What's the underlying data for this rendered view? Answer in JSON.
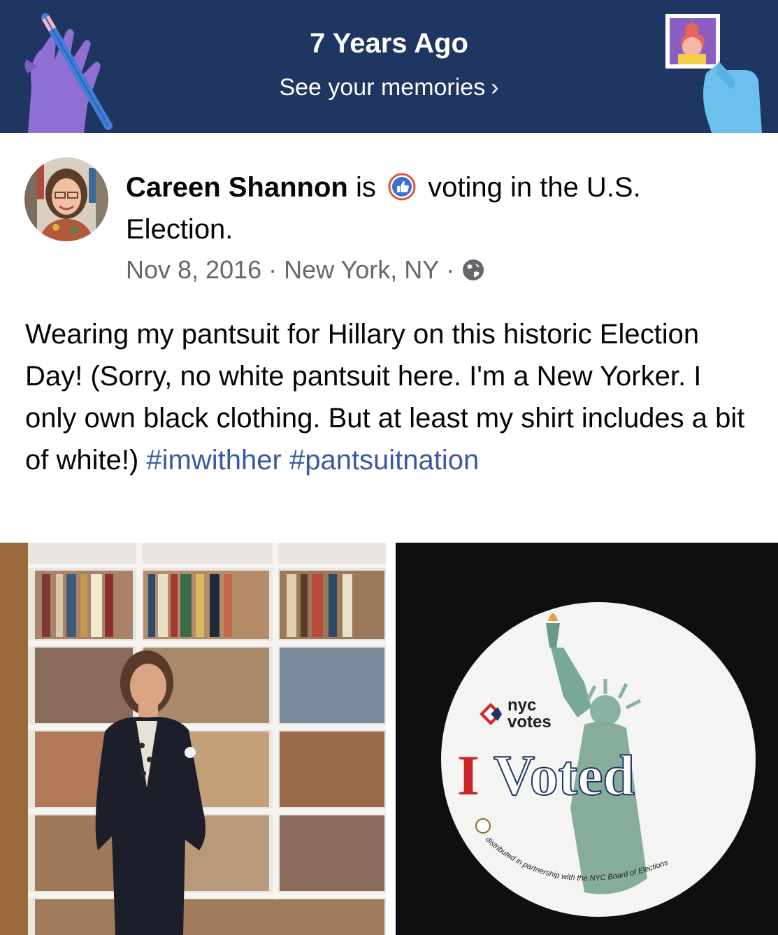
{
  "banner": {
    "title": "7 Years Ago",
    "link": "See your memories",
    "chevron": "›",
    "bg_color": "#1f3562"
  },
  "post": {
    "author": "Careen Shannon",
    "verb": "is",
    "activity_icon": "thumbs-up-icon",
    "activity": "voting in the U.S. Election.",
    "date": "Nov 8, 2016",
    "separator": "·",
    "location": "New York, NY",
    "privacy_icon": "globe-icon",
    "text": "Wearing my pantsuit for Hillary on this historic Election Day! (Sorry, no white pantsuit here. I'm a New Yorker. I only own black clothing. But at least my shirt includes a bit of white!)",
    "hashtags": [
      "#imwithher",
      "#pantsuitnation"
    ],
    "hashtag_color": "#3a5a9f"
  },
  "sticker": {
    "logo_line1": "nyc",
    "logo_line2": "votes",
    "letter_i": "I",
    "word_voted": "Voted",
    "footer": "distributed in partnership with the NYC Board of Elections"
  }
}
